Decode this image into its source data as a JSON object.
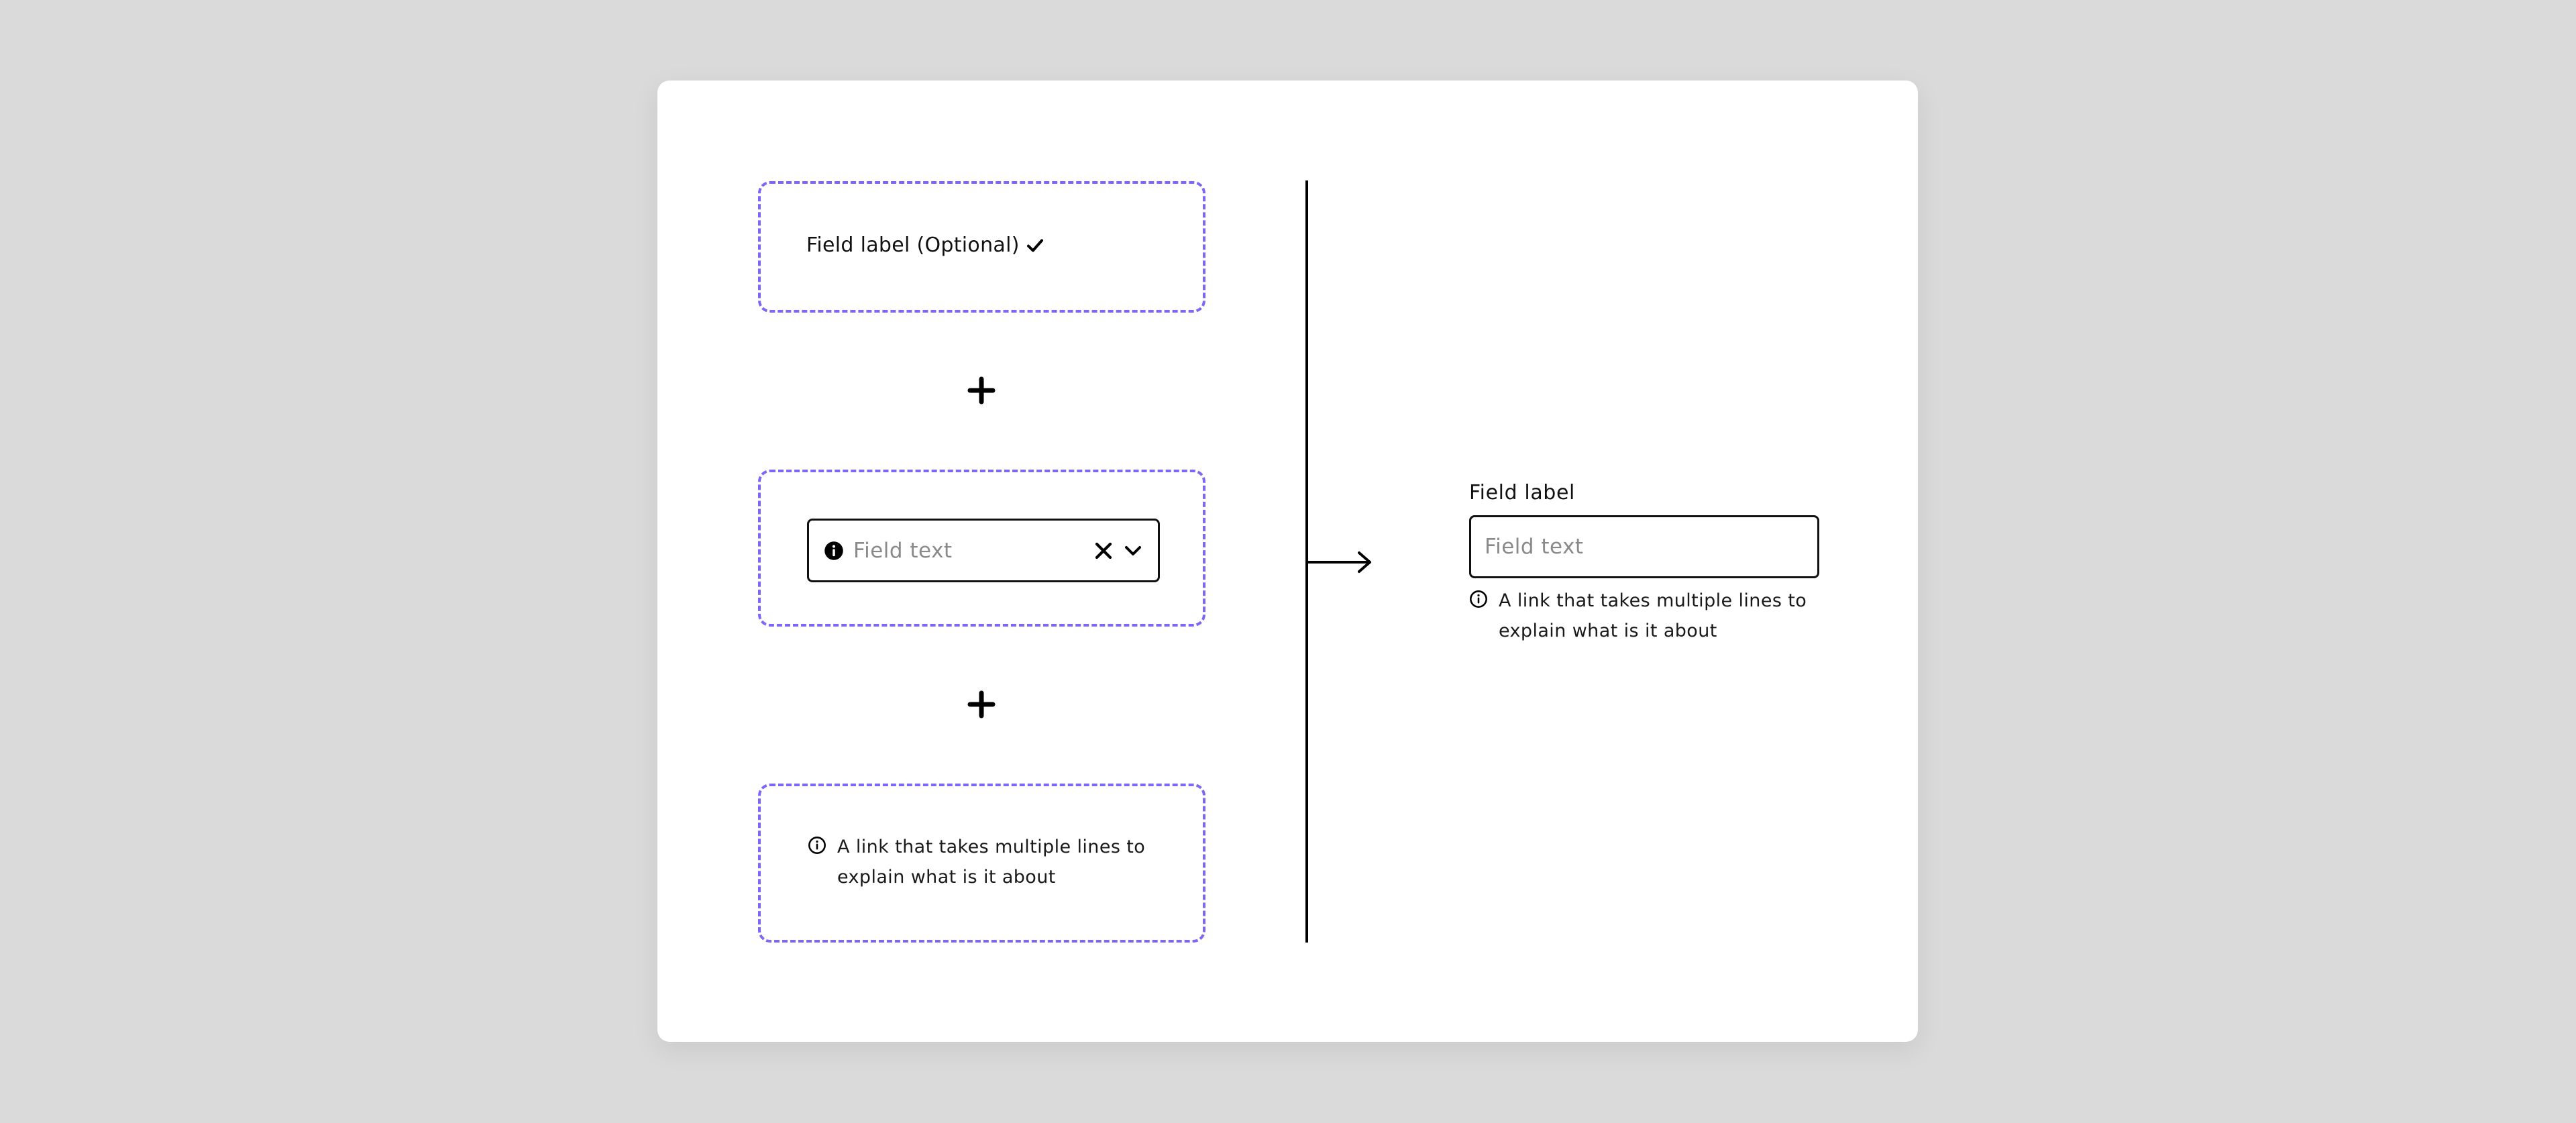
{
  "colors": {
    "background": "#dadada",
    "card": "#ffffff",
    "dashed_border": "#7b68f6",
    "text": "#111111",
    "placeholder": "#8a8a8a"
  },
  "left_parts": {
    "label_part": {
      "label_text": "Field label (Optional)",
      "trailing_icon": "check-icon"
    },
    "plus_1": "plus-icon",
    "input_part": {
      "leading_icon": "info-filled-icon",
      "placeholder": "Field text",
      "clear_icon": "close-icon",
      "dropdown_icon": "chevron-down-icon"
    },
    "plus_2": "plus-icon",
    "helper_part": {
      "icon": "info-outline-icon",
      "text": "A link that takes multiple lines to explain what is it about"
    }
  },
  "connector": {
    "divider": "vertical-line",
    "arrow_icon": "arrow-right-icon"
  },
  "result": {
    "label": "Field label",
    "placeholder": "Field text",
    "helper_icon": "info-outline-icon",
    "helper_text": "A link that takes multiple lines to explain what is it about"
  }
}
